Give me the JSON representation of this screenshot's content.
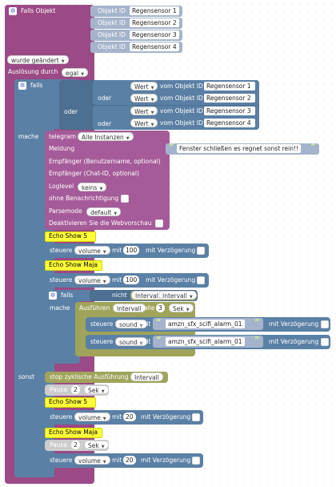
{
  "trigger": {
    "title": "Falls Objekt",
    "objects": [
      {
        "label": "Objekt ID",
        "value": "Regensensor 1"
      },
      {
        "label": "Objekt ID",
        "value": "Regensensor 2"
      },
      {
        "label": "Objekt ID",
        "value": "Regensensor 3"
      },
      {
        "label": "Objekt ID",
        "value": "Regensensor 4"
      }
    ],
    "change_mode": "wurde geändert",
    "trigger_label": "Auslösung durch",
    "trigger_value": "egal"
  },
  "if_block": {
    "label": "falls",
    "operator_or": "oder",
    "inner_or": "oder",
    "conditions": [
      {
        "prop": "Wert",
        "of": "vom Objekt ID",
        "obj": "Regensensor 1"
      },
      {
        "prop": "Wert",
        "of": "vom Objekt ID",
        "obj": "Regensensor 2"
      },
      {
        "prop": "Wert",
        "of": "vom Objekt ID",
        "obj": "Regensensor 3"
      },
      {
        "prop": "Wert",
        "of": "vom Objekt ID",
        "obj": "Regensensor 4"
      }
    ],
    "do_label": "mache",
    "else_label": "sonst"
  },
  "telegram": {
    "title": "telegram",
    "instance": "Alle Instanzen",
    "message_label": "Meldung",
    "message": "Fenster schließen es regnet sonst rein!!",
    "recipient_label": "Empfänger (Benutzername, optional)",
    "chat_label": "Empfänger (Chat-ID, optional)",
    "loglevel_label": "Loglevel",
    "loglevel": "keins",
    "silent_label": "ohne Benachrichtigung",
    "parsemode_label": "Parsemode",
    "parsemode": "default",
    "preview_label": "Deaktivieren Sie die Webvorschau"
  },
  "do_items": {
    "echo_show_5": "Echo Show 5",
    "echo_show_maja": "Echo Show Maja",
    "control1": {
      "label": "steuere",
      "prop": "volume",
      "with": "mit",
      "value": "100",
      "delay": "mit Verzögerung"
    },
    "control2": {
      "label": "steuere",
      "prop": "volume",
      "with": "mit",
      "value": "100",
      "delay": "mit Verzögerung"
    }
  },
  "nested_if": {
    "label": "falls",
    "not": "nicht",
    "interval_field": "Intervall",
    "interval_dd": "Intervall",
    "do_label": "mache",
    "exec_label": "Ausführen",
    "exec_name": "Intervall",
    "every": "alle",
    "count": "3",
    "unit": "Sek",
    "sound1": {
      "label": "steuere",
      "prop": "sound",
      "with": "mit",
      "value": "amzn_sfx_scifi_alarm_01",
      "delay": "mit Verzögerung"
    },
    "sound2": {
      "label": "steuere",
      "prop": "sound",
      "with": "mit",
      "value": "amzn_sfx_scifi_alarm_01",
      "delay": "mit Verzögerung"
    }
  },
  "else_items": {
    "stop_label": "stop zyklische Ausführung",
    "stop_value": "Intervall",
    "pause1": {
      "label": "Pause",
      "value": "2",
      "unit": "Sek"
    },
    "echo_show_5": "Echo Show 5",
    "control1": {
      "label": "steuere",
      "prop": "volume",
      "with": "mit",
      "value": "20",
      "delay": "mit Verzögerung"
    },
    "echo_show_maja": "Echo Show Maja",
    "pause2": {
      "label": "Pause",
      "value": "2",
      "unit": "Sek"
    },
    "control2": {
      "label": "steuere",
      "prop": "volume",
      "with": "mit",
      "value": "20",
      "delay": "mit Verzögerung"
    }
  }
}
